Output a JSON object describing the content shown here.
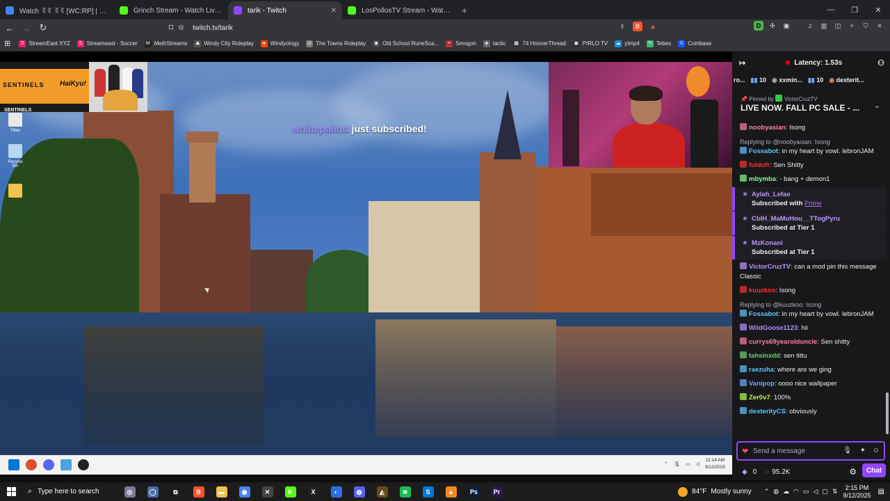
{
  "browser": {
    "tabs": [
      {
        "label": "Watch ꉂꉂ ꉂꉂ [WC:RP] | Streamable",
        "color": "#4285f4",
        "active": false
      },
      {
        "label": "Grinch Stream - Watch Live on Kick",
        "color": "#53fc18",
        "active": false
      },
      {
        "label": "tarik - Twitch",
        "color": "#9147ff",
        "active": true
      },
      {
        "label": "LosPollosTV Stream - Watch Live on",
        "color": "#53fc18",
        "active": false
      }
    ],
    "url": "twitch.tv/tarik",
    "bookmarks": [
      {
        "label": "StreamEast XYZ",
        "color": "#e91e63",
        "glyph": "S"
      },
      {
        "label": "Streameast - Soccer",
        "color": "#e91e63",
        "glyph": "S"
      },
      {
        "label": "MethStreams",
        "color": "#222222",
        "glyph": "M"
      },
      {
        "label": "Windy City Roleplay",
        "color": "#555555",
        "glyph": "⛰"
      },
      {
        "label": "Windyology",
        "color": "#ff4500",
        "glyph": "●"
      },
      {
        "label": "The Towns Roleplay",
        "color": "#777777",
        "glyph": "◎"
      },
      {
        "label": "Old School RuneSca...",
        "color": "#444444",
        "glyph": "◉"
      },
      {
        "label": "Smogon",
        "color": "#b0303f",
        "glyph": "◓"
      },
      {
        "label": "tactic",
        "color": "#666666",
        "glyph": "◈"
      },
      {
        "label": "74 HooverThread",
        "color": "#333333",
        "glyph": "▦"
      },
      {
        "label": "PIRLO TV",
        "color": "#2a2a2a",
        "glyph": "▣"
      },
      {
        "label": "ytmp4",
        "color": "#1e88e5",
        "glyph": "☁"
      },
      {
        "label": "Tebex",
        "color": "#3cb371",
        "glyph": "✎"
      },
      {
        "label": "Coinbase",
        "color": "#1652f0",
        "glyph": "©"
      }
    ]
  },
  "stream": {
    "overlay_brand": "SENTINELS",
    "overlay_partner": "HaiKyu!",
    "overlay_small": "SENTINELS",
    "sub_alert_name": "whiitepaiintt",
    "sub_alert_text": " just subscribed!",
    "desktop_icons": [
      {
        "label": "Titles",
        "color": "#e8e8e8"
      },
      {
        "label": "Recycle Bin",
        "color": "#b8d6f0"
      },
      {
        "label": "",
        "color": "#f2c14e"
      }
    ],
    "inner_time": "11:14 AM",
    "inner_date": "9/12/2025"
  },
  "chat": {
    "latency": "Latency: 1.53s",
    "leaders": [
      {
        "count": "10",
        "name": ""
      },
      {
        "count": "",
        "name": "xxmin..."
      },
      {
        "count": "10",
        "name": ""
      },
      {
        "count": "",
        "name": "dexterit..."
      }
    ],
    "leaders_prefix": "ro...",
    "pinned_by_label": "Pinned by",
    "pinned_by_user": "VictorCruzTV",
    "pinned_text": "LIVE NOW. FALL PC SALE - ...",
    "messages": [
      {
        "kind": "msg",
        "user": "noobyasian",
        "color": "#ff7fa0",
        "text": ": Isong"
      },
      {
        "kind": "reply",
        "reply_to": "Replying to @noobyasian: Isong",
        "user": "Fossabot",
        "color": "#5cc7ff",
        "text": ": in my heart by vowl. lebronJAM"
      },
      {
        "kind": "msg",
        "user": "fuldufr",
        "color": "#ff3030",
        "text": ": Sen Shitty"
      },
      {
        "kind": "msg",
        "user": "mbymba",
        "color": "#8aff8a",
        "text": ": - bang + demon1"
      },
      {
        "kind": "sub",
        "user": "Aylah_Lefae",
        "line2": "Subscribed with ",
        "prime": "Prime"
      },
      {
        "kind": "sub",
        "user": "CbIH_MaMuHou__TTogPyru",
        "line2": "Subscribed at Tier 1",
        "prime": ""
      },
      {
        "kind": "sub",
        "user": "MzKonani",
        "line2": "Subscribed at Tier 1",
        "prime": ""
      },
      {
        "kind": "msg",
        "user": "VictorCruzTV",
        "color": "#bf94ff",
        "text": ": can a mod pin this message Classic"
      },
      {
        "kind": "msg",
        "user": "kuuzkoo",
        "color": "#ff3030",
        "text": ": Isong"
      },
      {
        "kind": "reply",
        "reply_to": "Replying to @kuuzkoo: Isong",
        "user": "Fossabot",
        "color": "#5cc7ff",
        "text": ": in my heart by vowl. lebronJAM"
      },
      {
        "kind": "msg",
        "user": "WildGoose1123",
        "color": "#b38cff",
        "text": ": hii"
      },
      {
        "kind": "msg",
        "user": "currys69yearolduncle",
        "color": "#ff7fa0",
        "text": ": Sen shitty"
      },
      {
        "kind": "msg",
        "user": "tahsinxdd",
        "color": "#6fd06f",
        "text": ": sen tittu"
      },
      {
        "kind": "msg",
        "user": "raezuha",
        "color": "#5cc7ff",
        "text": ": where are we ging"
      },
      {
        "kind": "msg",
        "user": "Vanipop",
        "color": "#6fa8ff",
        "text": ": oooo nice wallpaper"
      },
      {
        "kind": "msg",
        "user": "Zer0v7",
        "color": "#b7ff4a",
        "text": ": 100%"
      },
      {
        "kind": "msg",
        "user": "dexterityCS",
        "color": "#5cc7ff",
        "text": ": obviously"
      }
    ],
    "input_placeholder": "Send a message",
    "points": "0",
    "viewers": "95.2K",
    "chat_button": "Chat"
  },
  "taskbar": {
    "search_placeholder": "Type here to search",
    "weather_temp": "84°F",
    "weather_desc": "Mostly sunny",
    "time": "2:15 PM",
    "date": "9/12/2025",
    "apps": [
      {
        "name": "brave-icon",
        "color": "#fb542b",
        "glyph": "B"
      },
      {
        "name": "file-explorer-icon",
        "color": "#f2c14e",
        "glyph": "▬"
      },
      {
        "name": "chrome-icon",
        "color": "#4285f4",
        "glyph": "◉"
      },
      {
        "name": "app-x-icon",
        "color": "#444444",
        "glyph": "✕"
      },
      {
        "name": "kick-icon",
        "color": "#53fc18",
        "glyph": "K"
      },
      {
        "name": "x-icon",
        "color": "#222222",
        "glyph": "X"
      },
      {
        "name": "app-blue-icon",
        "color": "#2d6fe0",
        "glyph": "◐"
      },
      {
        "name": "discord-icon",
        "color": "#5865f2",
        "glyph": "◍"
      },
      {
        "name": "game-icon",
        "color": "#6a4a1a",
        "glyph": "◭"
      },
      {
        "name": "spotify-icon",
        "color": "#1db954",
        "glyph": "≋"
      },
      {
        "name": "skype-icon",
        "color": "#0078d4",
        "glyph": "S"
      },
      {
        "name": "vlc-icon",
        "color": "#f08a1a",
        "glyph": "▲"
      },
      {
        "name": "photoshop-icon",
        "color": "#0a1f3a",
        "glyph": "Ps"
      },
      {
        "name": "premiere-icon",
        "color": "#2a1a4a",
        "glyph": "Pr"
      }
    ]
  }
}
